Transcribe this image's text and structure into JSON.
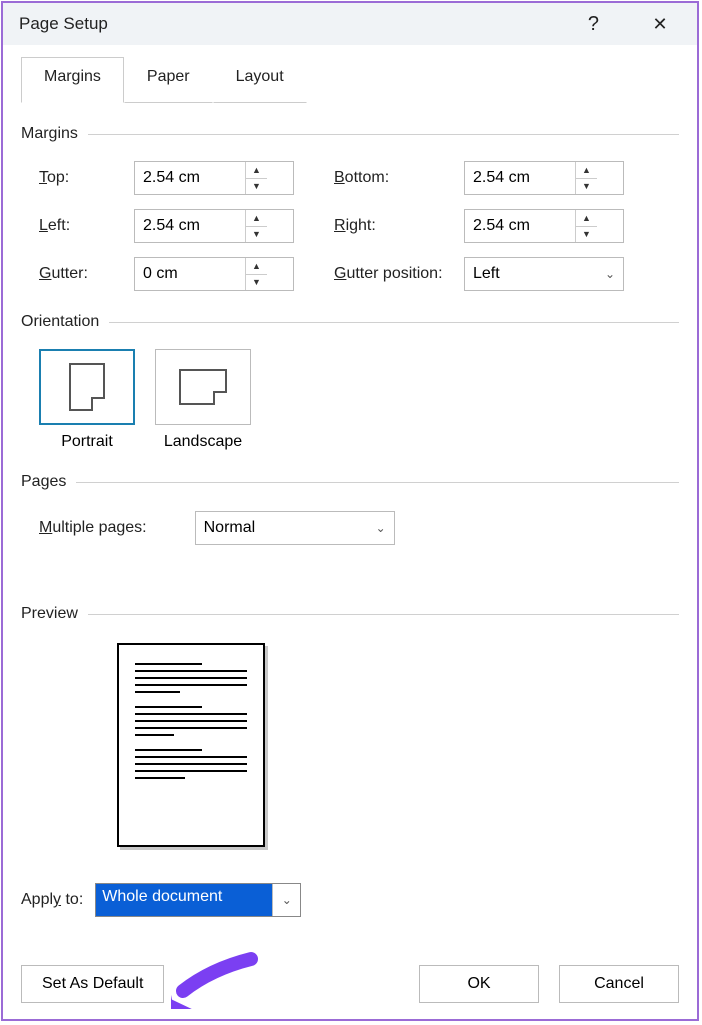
{
  "title": "Page Setup",
  "tabs": {
    "margins": "Margins",
    "paper": "Paper",
    "layout": "Layout"
  },
  "sections": {
    "margins": "Margins",
    "orientation": "Orientation",
    "pages": "Pages",
    "preview": "Preview"
  },
  "margin_labels": {
    "top": "op:",
    "bottom": "ottom:",
    "left": "eft:",
    "right": "ight:",
    "gutter": "utter:",
    "gutter_pos": "utter position:"
  },
  "margin_accel": {
    "top": "T",
    "bottom": "B",
    "left": "L",
    "right": "R",
    "gutter": "G",
    "gutter_pos": "G"
  },
  "margins": {
    "top": "2.54 cm",
    "bottom": "2.54 cm",
    "left": "2.54 cm",
    "right": "2.54 cm",
    "gutter": "0 cm",
    "gutter_pos": "Left"
  },
  "orientation": {
    "portrait_prefix": "P",
    "portrait_rest": "ortrait",
    "landscape_prefix": "Land",
    "landscape_u": "s",
    "landscape_rest": "cape"
  },
  "pages": {
    "label_prefix": "M",
    "label_rest": "ultiple pages:",
    "value": "Normal"
  },
  "apply": {
    "label_prefix": "Appl",
    "label_u": "y",
    "label_rest": " to:",
    "value": "Whole document"
  },
  "buttons": {
    "default_prefix": "Set As ",
    "default_u": "D",
    "default_rest": "efault",
    "ok": "OK",
    "cancel": "Cancel"
  }
}
